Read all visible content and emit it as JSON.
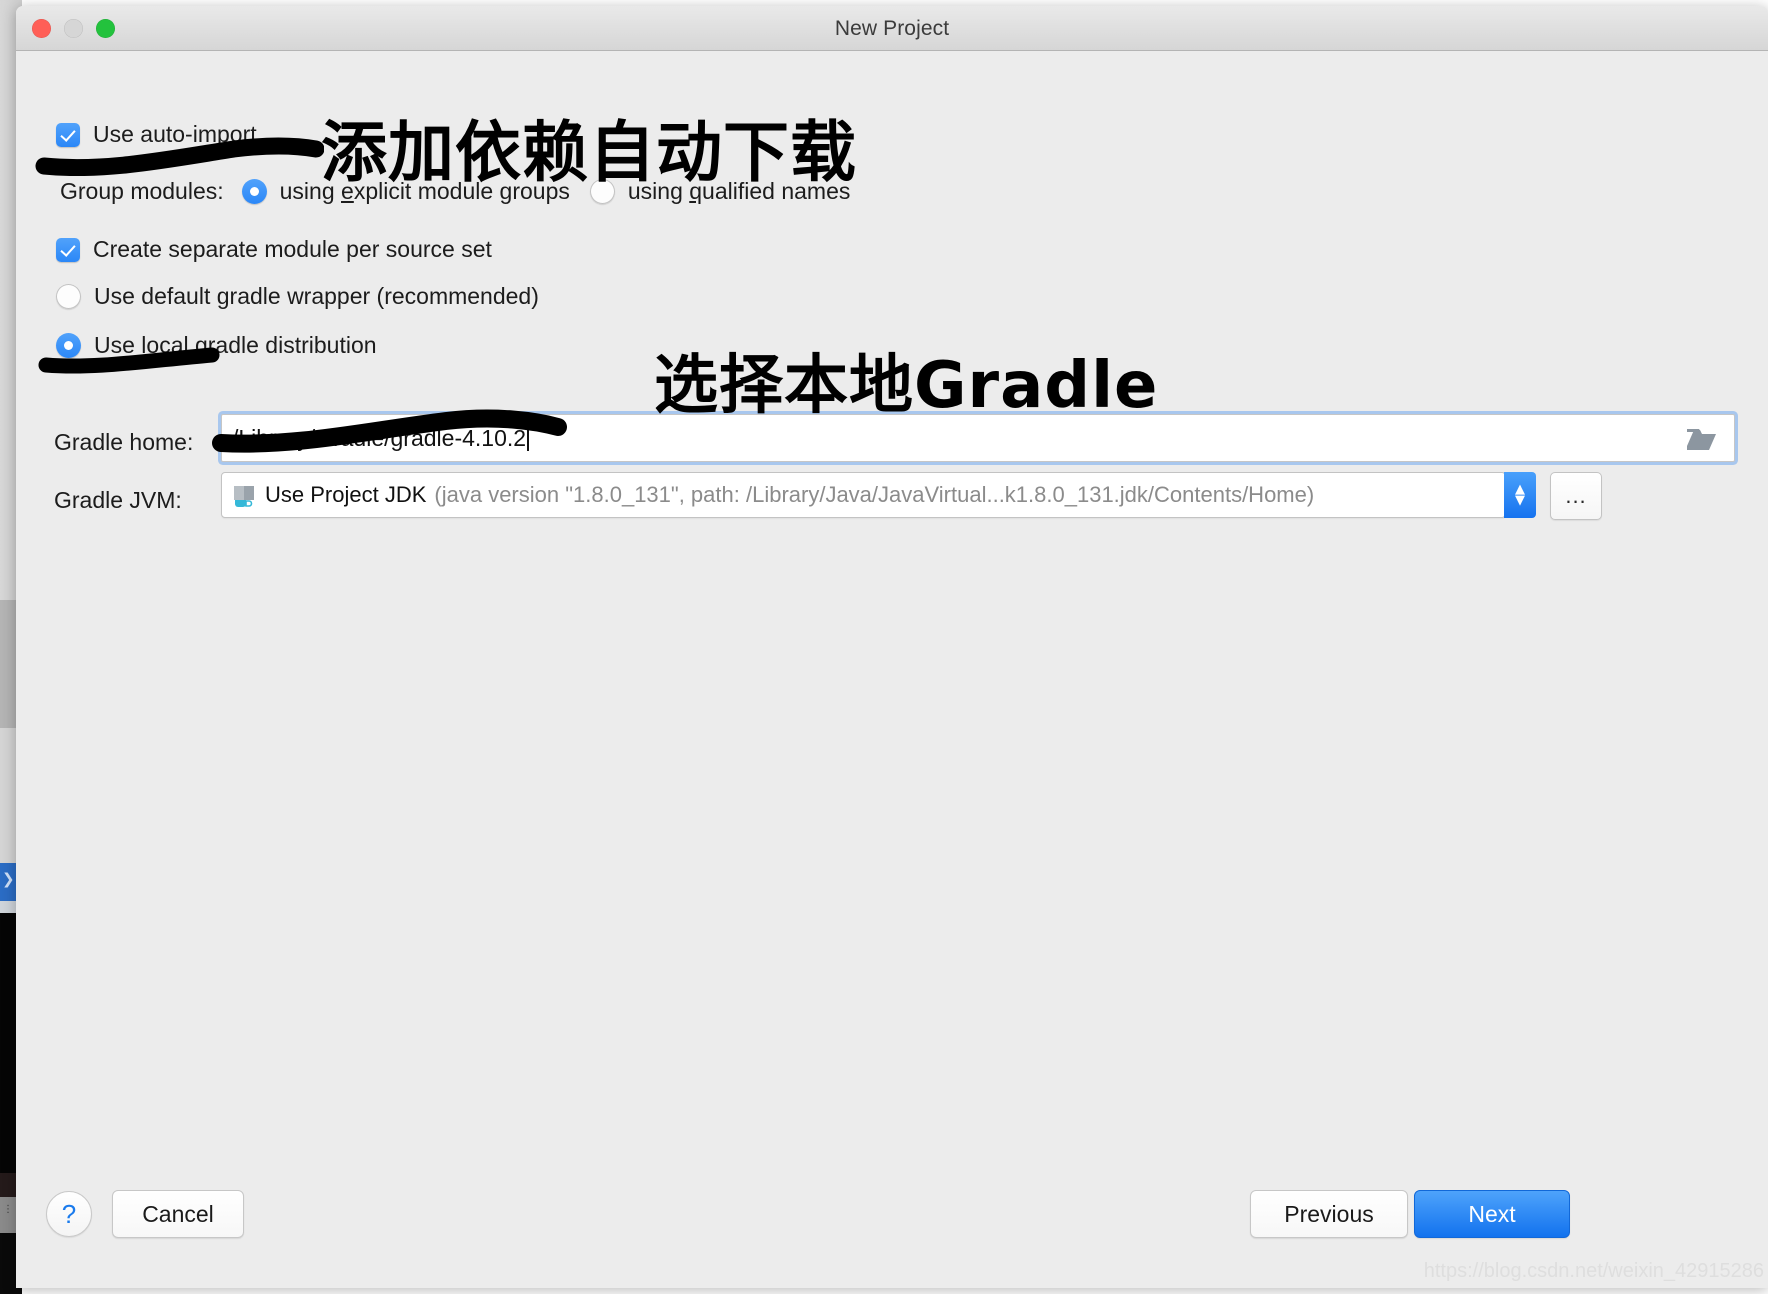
{
  "window": {
    "title": "New Project",
    "traffic_lights": [
      "close",
      "minimize",
      "zoom"
    ]
  },
  "options": {
    "auto_import": {
      "label": "Use auto-import",
      "checked": true
    },
    "group_modules": {
      "label": "Group modules:",
      "choices": [
        {
          "label": "using explicit module groups",
          "mnemonic": "e",
          "selected": true
        },
        {
          "label": "using qualified names",
          "mnemonic": "q",
          "selected": false
        }
      ]
    },
    "separate_module": {
      "label": "Create separate module per source set",
      "checked": true
    },
    "distribution": {
      "choices": [
        {
          "label": "Use default gradle wrapper (recommended)",
          "selected": false
        },
        {
          "label": "Use local gradle distribution",
          "selected": true
        }
      ]
    }
  },
  "gradle_home": {
    "label": "Gradle home:",
    "value": "/Library/Gradle/gradle-4.10.2",
    "browse_icon": "folder-icon"
  },
  "gradle_jvm": {
    "label": "Gradle JVM:",
    "icon": "jdk-icon",
    "selected_main": "Use Project JDK",
    "selected_detail": "(java version \"1.8.0_131\", path: /Library/Java/JavaVirtual...k1.8.0_131.jdk/Contents/Home)",
    "stepper_up": "▲",
    "stepper_down": "▼",
    "ellipsis_label": "..."
  },
  "annotations": {
    "auto_import_note": "添加依赖自动下载",
    "local_gradle_note": "选择本地Gradle"
  },
  "footer": {
    "help_label": "?",
    "cancel_label": "Cancel",
    "previous_label": "Previous",
    "next_label": "Next"
  },
  "watermark": "https://blog.csdn.net/weixin_42915286",
  "colors": {
    "accent_blue": "#2b87f7",
    "next_button_blue": "#1272ee",
    "dialog_bg": "#ececec",
    "marker_black": "#000000",
    "detail_grey": "#8b8b8b"
  }
}
